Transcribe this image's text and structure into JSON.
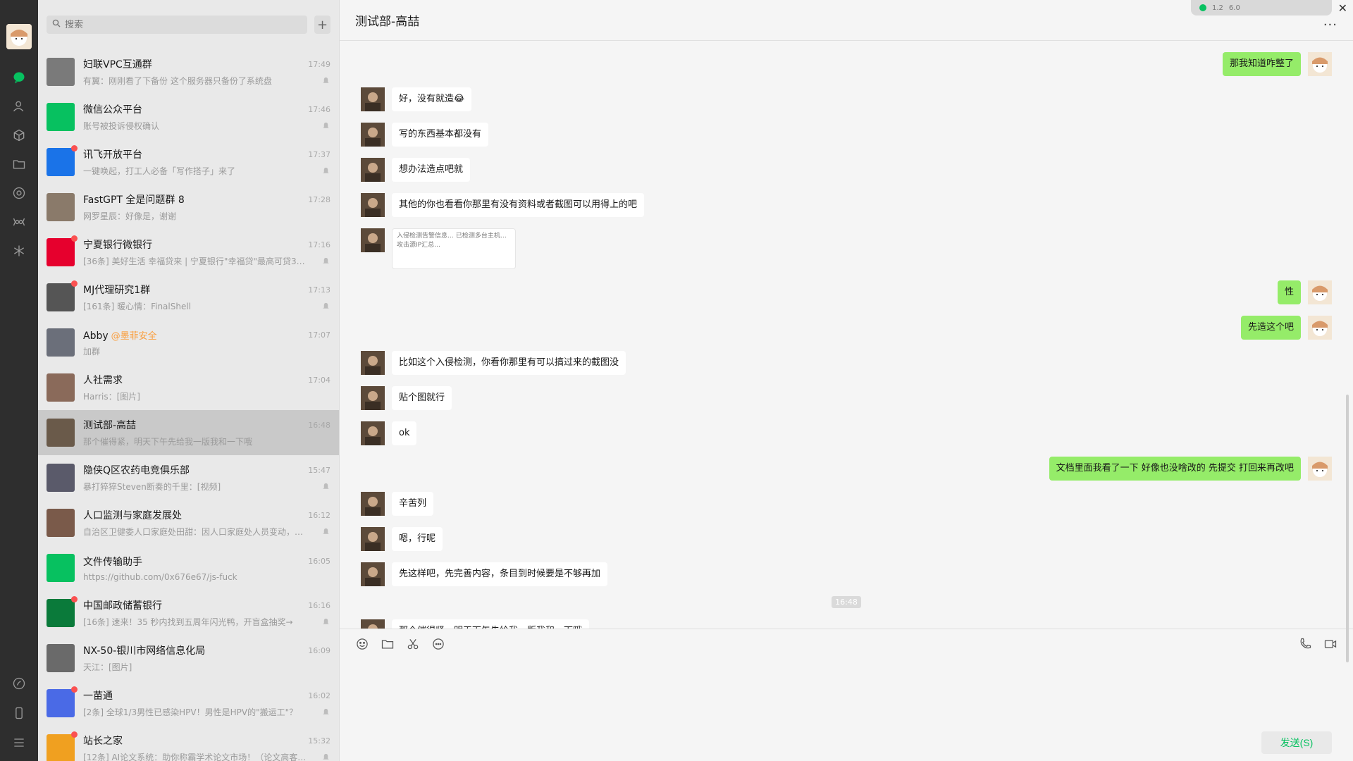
{
  "window": {
    "close_symbol": "✕",
    "widget_text_1": "1.2",
    "widget_text_2": "6.0"
  },
  "search": {
    "placeholder": "搜索",
    "add": "+"
  },
  "chats": [
    {
      "name": "妇联VPC互通群",
      "time": "17:49",
      "preview": "有翼：刚刚看了下备份 这个服务器只备份了系统盘",
      "muted": true,
      "dot": false,
      "color": "#7a7a7a"
    },
    {
      "name": "微信公众平台",
      "time": "17:46",
      "preview": "账号被投诉侵权确认",
      "muted": true,
      "dot": false,
      "color": "#07c160"
    },
    {
      "name": "讯飞开放平台",
      "time": "17:37",
      "preview": "一键唤起，打工人必备「写作搭子」来了",
      "muted": true,
      "dot": true,
      "color": "#1a73e8"
    },
    {
      "name": "FastGPT 全是问题群 8",
      "time": "17:28",
      "preview": "网罗星辰：好像是，谢谢",
      "muted": false,
      "dot": false,
      "color": "#8a7a6a"
    },
    {
      "name": "宁夏银行微银行",
      "time": "17:16",
      "preview": "[36条] 美好生活 幸福贷来 | 宁夏银行\"幸福贷\"最高可贷30万...",
      "muted": true,
      "dot": true,
      "color": "#e6002d"
    },
    {
      "name": "MJ代理研究1群",
      "time": "17:13",
      "preview": "[161条] 暖心情：FinalShell",
      "muted": true,
      "dot": true,
      "color": "#555555"
    },
    {
      "name": "Abby",
      "tag": "@墨菲安全",
      "time": "17:07",
      "preview": "加群",
      "muted": false,
      "dot": false,
      "color": "#6b6f7a"
    },
    {
      "name": "人社需求",
      "time": "17:04",
      "preview": "Harris：[图片]",
      "muted": false,
      "dot": false,
      "color": "#8a6a5a"
    },
    {
      "name": "测试部-高喆",
      "time": "16:48",
      "preview": "那个催得紧，明天下午先给我一版我和一下哦",
      "muted": false,
      "dot": false,
      "color": "#6a5a4a",
      "active": true
    },
    {
      "name": "隐侠Q区农药电竞俱乐部",
      "time": "15:47",
      "preview": "暴打猝猝Steven断奏的千里：[视频]",
      "muted": true,
      "dot": false,
      "color": "#5a5a6a"
    },
    {
      "name": "人口监测与家庭发展处",
      "time": "16:12",
      "preview": "自治区卫健委人口家庭处田甜：因人口家庭处人员变动，这...",
      "muted": true,
      "dot": false,
      "color": "#7a5a4a"
    },
    {
      "name": "文件传输助手",
      "time": "16:05",
      "preview": "https://github.com/0x676e67/js-fuck",
      "muted": false,
      "dot": false,
      "color": "#07c160"
    },
    {
      "name": "中国邮政储蓄银行",
      "time": "16:16",
      "preview": "[16条] 速来！35 秒内找到五周年闪光鸭，开盲盒抽奖→",
      "muted": true,
      "dot": true,
      "color": "#0a7a3a"
    },
    {
      "name": "NX-50-银川市网络信息化局",
      "time": "16:09",
      "preview": "天江：[图片]",
      "muted": false,
      "dot": false,
      "color": "#6a6a6a"
    },
    {
      "name": "一苗通",
      "time": "16:02",
      "preview": "[2条] 全球1/3男性已感染HPV！男性是HPV的\"搬运工\"？",
      "muted": true,
      "dot": true,
      "color": "#4a6ae6"
    },
    {
      "name": "站长之家",
      "time": "15:32",
      "preview": "[12条] AI论文系统：助你称霸学术论文市场！（论文高客单...",
      "muted": true,
      "dot": true,
      "color": "#f0a020"
    }
  ],
  "main": {
    "title": "测试部-高喆",
    "more": "···",
    "messages": [
      {
        "side": "right",
        "text": "那我知道咋整了"
      },
      {
        "side": "left",
        "text": "好，没有就造😂"
      },
      {
        "side": "left",
        "text": "写的东西基本都没有"
      },
      {
        "side": "left",
        "text": "想办法造点吧就"
      },
      {
        "side": "left",
        "text": "其他的你也看看你那里有没有资料或者截图可以用得上的吧"
      },
      {
        "side": "left",
        "image": true,
        "text": "入侵检测告警信息…  已检测多台主机…  攻击源IP汇总…"
      },
      {
        "side": "right",
        "text": "性"
      },
      {
        "side": "right",
        "text": "先造这个吧"
      },
      {
        "side": "left",
        "text": "比如这个入侵检测，你看你那里有可以搞过来的截图没"
      },
      {
        "side": "left",
        "text": "贴个图就行"
      },
      {
        "side": "left",
        "text": "ok"
      },
      {
        "side": "right",
        "text": "文档里面我看了一下 好像也没啥改的 先提交  打回来再改吧"
      },
      {
        "side": "left",
        "text": "辛苦列"
      },
      {
        "side": "left",
        "text": "嗯，行呢"
      },
      {
        "side": "left",
        "text": "先这样吧，先完善内容，条目到时候要是不够再加"
      },
      {
        "time": "16:48"
      },
      {
        "side": "left",
        "text": "那个催得紧，明天下午先给我一版我和一下哦"
      }
    ],
    "send_label": "发送(S)"
  },
  "colors": {
    "accent": "#07c160",
    "bubble_self": "#95ec69",
    "nav_bg": "#2e2e2e"
  }
}
